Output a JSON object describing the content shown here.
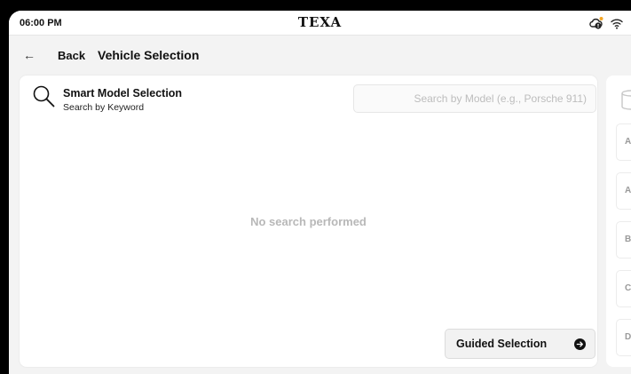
{
  "status_bar": {
    "time": "06:00 PM",
    "brand": "TEXA"
  },
  "nav": {
    "back_label": "Back",
    "title": "Vehicle Selection"
  },
  "smart_selection": {
    "title": "Smart Model Selection",
    "subtitle": "Search by Keyword",
    "search_placeholder": "Search by Model (e.g., Porsche 911)",
    "search_value": "",
    "empty_message": "No search performed",
    "guided_button_label": "Guided Selection"
  },
  "brand_index": {
    "letters": [
      "A",
      "A",
      "B",
      "C",
      "D"
    ]
  },
  "colors": {
    "background": "#f3f3f3",
    "card": "#ffffff",
    "muted_text": "#b8b8b8",
    "accent_dark": "#111111"
  }
}
